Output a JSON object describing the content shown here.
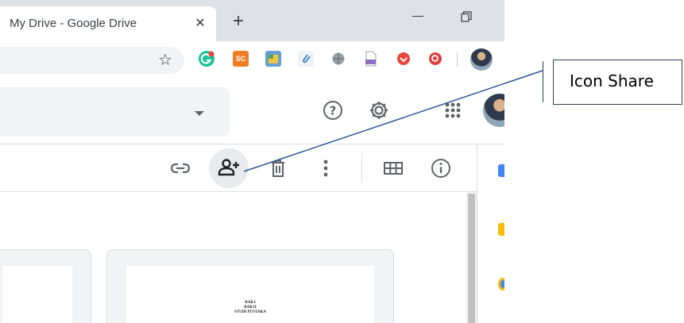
{
  "browser": {
    "tab_title": "My Drive - Google Drive",
    "close_glyph": "✕",
    "newtab_glyph": "+",
    "star_glyph": "☆",
    "extensions": [
      {
        "name": "grammarly-extension-icon",
        "color": "#15c39a",
        "label": ""
      },
      {
        "name": "sc-extension-icon",
        "color": "#f07c26",
        "label": "SC"
      },
      {
        "name": "box-extension-icon",
        "color": "#63a0d3",
        "label": ""
      },
      {
        "name": "attachment-extension-icon",
        "color": "#5f9ec7",
        "label": ""
      },
      {
        "name": "globe-extension-icon",
        "color": "#8a8f94",
        "label": ""
      },
      {
        "name": "pdf-extension-icon",
        "color": "#8e6fc4",
        "label": "PDF"
      },
      {
        "name": "pocket-extension-icon",
        "color": "#e8453c",
        "label": ""
      },
      {
        "name": "search-extension-icon",
        "color": "#e03d3d",
        "label": ""
      }
    ]
  },
  "drive": {
    "help_glyph": "?",
    "more_glyph": "⋮"
  },
  "document_preview": {
    "line1": "BAB I",
    "line2": "BAB II",
    "line3": "STUDI PUSTAKA"
  },
  "annotation": {
    "label": "Icon Share"
  },
  "colors": {
    "tabstrip": "#dee1e6",
    "icon": "#5f6368",
    "share_highlight": "#e8eaed",
    "callout_border": "#2f3e55"
  }
}
